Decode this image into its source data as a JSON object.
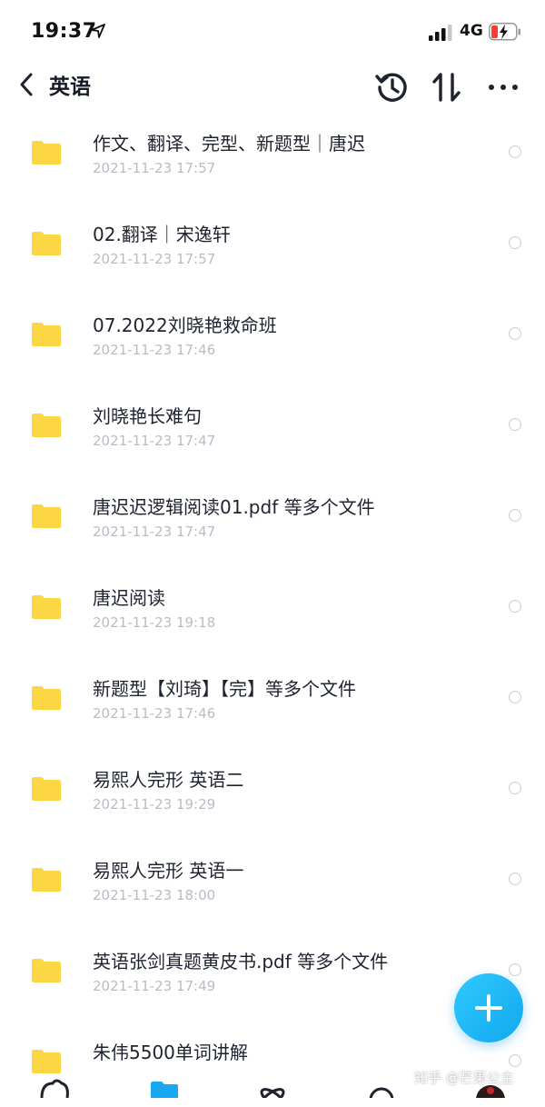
{
  "status_bar": {
    "time": "19:37",
    "network": "4G"
  },
  "header": {
    "title": "英语"
  },
  "files": [
    {
      "name": "作文、翻译、完型、新题型｜唐迟",
      "date": "2021-11-23 17:57"
    },
    {
      "name": "02.翻译｜宋逸轩",
      "date": "2021-11-23 17:57"
    },
    {
      "name": "07.2022刘晓艳救命班",
      "date": "2021-11-23 17:46"
    },
    {
      "name": "刘晓艳长难句",
      "date": "2021-11-23 17:47"
    },
    {
      "name": "唐迟迟逻辑阅读01.pdf 等多个文件",
      "date": "2021-11-23 17:47"
    },
    {
      "name": "唐迟阅读",
      "date": "2021-11-23 19:18"
    },
    {
      "name": "新题型【刘琦】【完】等多个文件",
      "date": "2021-11-23 17:46"
    },
    {
      "name": "易熙人完形 英语二",
      "date": "2021-11-23 19:29"
    },
    {
      "name": "易熙人完形 英语一",
      "date": "2021-11-23 18:00"
    },
    {
      "name": "英语张剑真题黄皮书.pdf 等多个文件",
      "date": "2021-11-23 17:49"
    },
    {
      "name": "朱伟5500单词讲解",
      "date": ""
    }
  ],
  "watermark": "知乎 @芒果公主",
  "colors": {
    "accent": "#1aa9f0",
    "folder": "#fdd646",
    "date_text": "#b8bcc6"
  },
  "icons": {
    "back": "chevron-left-icon",
    "history": "history-icon",
    "sort": "sort-icon",
    "more": "more-icon",
    "folder": "folder-icon",
    "fab": "plus-icon"
  }
}
